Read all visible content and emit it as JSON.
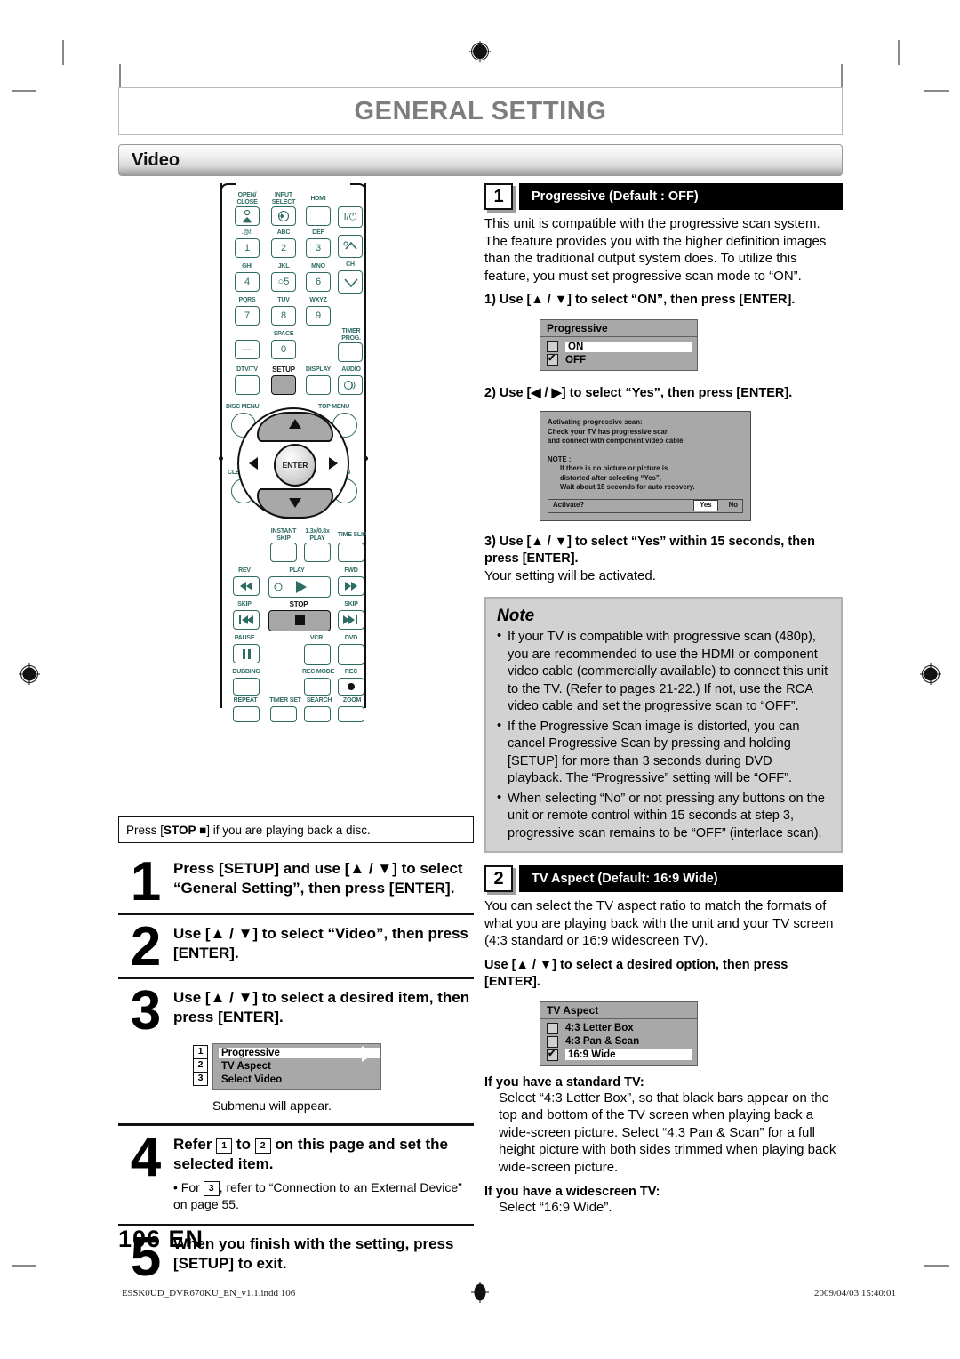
{
  "header": {
    "title": "GENERAL SETTING",
    "section": "Video"
  },
  "remote": {
    "labels": {
      "open_close": "OPEN/\nCLOSE",
      "input_select": "INPUT\nSELECT",
      "hdmi": "HDMI",
      "power": "I/⏻",
      "k1_sub": ".@/:",
      "k2_sub": "ABC",
      "k3_sub": "DEF",
      "k4_sub": "GHI",
      "k5_sub": "JKL",
      "k6_sub": "MNO",
      "k7_sub": "PQRS",
      "k8_sub": "TUV",
      "k9_sub": "WXYZ",
      "k0_sub": "SPACE",
      "n1": "1",
      "n2": "2",
      "n3": "3",
      "n4": "4",
      "n5": "5",
      "n6": "6",
      "n7": "7",
      "n8": "8",
      "n9": "9",
      "n0": "0",
      "dash": "—",
      "ch": "CH",
      "timer_prog": "TIMER\nPROG.",
      "dtv_tv": "DTV/TV",
      "setup": "SETUP",
      "display": "DISPLAY",
      "audio": "AUDIO",
      "disc_menu": "DISC MENU",
      "top_menu": "TOP MENU",
      "enter": "ENTER",
      "clear": "CLEAR",
      "return": "RETURN",
      "instant_skip": "INSTANT\nSKIP",
      "play_13x": "1.3x/0.8x\nPLAY",
      "time_slip": "TIME SLIP",
      "rev": "REV",
      "play": "PLAY",
      "fwd": "FWD",
      "skip_back": "SKIP",
      "stop": "STOP",
      "skip_fwd": "SKIP",
      "pause": "PAUSE",
      "vcr": "VCR",
      "dvd": "DVD",
      "dubbing": "DUBBING",
      "rec_mode": "REC MODE",
      "rec": "REC",
      "repeat": "REPEAT",
      "timer_set": "TIMER SET",
      "search": "SEARCH",
      "zoom": "ZOOM"
    }
  },
  "caption": {
    "prefix": "Press [",
    "bold": "STOP ■",
    "suffix": "] if you are playing back a disc."
  },
  "steps": [
    {
      "num": "1",
      "text": "Press [SETUP] and use [▲ / ▼] to select “General Setting”, then press [ENTER]."
    },
    {
      "num": "2",
      "text": "Use [▲ / ▼] to select “Video”, then press [ENTER]."
    },
    {
      "num": "3",
      "text": "Use [▲ / ▼] to select a desired item, then press [ENTER].",
      "submenu": {
        "items": [
          {
            "tag": "1",
            "label": "Progressive",
            "highlight": true
          },
          {
            "tag": "2",
            "label": "TV Aspect",
            "highlight": false
          },
          {
            "tag": "3",
            "label": "Select Video",
            "highlight": false
          }
        ]
      },
      "note": "Submenu will appear."
    },
    {
      "num": "4",
      "text_parts": [
        "Refer ",
        "1",
        " to ",
        "2",
        " on this page and set the selected item."
      ],
      "bullet_parts": [
        "• For ",
        "3",
        ", refer to “Connection to an External Device” on page 55."
      ]
    },
    {
      "num": "5",
      "text": "When you finish with the setting, press [SETUP] to exit."
    }
  ],
  "sections": [
    {
      "num": "1",
      "title": "Progressive (Default : OFF)",
      "body": "This unit is compatible with the progressive scan system. The feature provides you with the higher definition images than the traditional output system does. To utilize this feature, you must set progressive scan mode to “ON”.",
      "step1": "1) Use [▲ / ▼] to select “ON”, then press [ENTER].",
      "menu": {
        "title": "Progressive",
        "options": [
          {
            "label": "ON",
            "checked": false,
            "selected": true
          },
          {
            "label": "OFF",
            "checked": true,
            "selected": false
          }
        ]
      },
      "step2": "2) Use [◀ / ▶] to select “Yes”, then press [ENTER].",
      "dialog": {
        "line1": "Activating progressive scan:",
        "line2": "Check your TV has progressive scan",
        "line3": "and connect with component video cable.",
        "note_label": "NOTE :",
        "note1": "If there is no picture or picture is",
        "note2": "distorted after selecting “Yes”,",
        "note3": "Wait about 15 seconds for auto recovery.",
        "question": "Activate?",
        "yes": "Yes",
        "no": "No"
      },
      "step3": "3) Use [▲ / ▼] to select “Yes” within 15 seconds, then press [ENTER].",
      "step3_sub": "Your setting will be activated.",
      "note": {
        "title": "Note",
        "items": [
          "If your TV is compatible with progressive scan (480p), you are recommended to use the HDMI or component video cable (commercially available) to connect this unit to the TV. (Refer to pages 21-22.) If not, use the RCA video cable and set the progressive scan to “OFF”.",
          "If the Progressive Scan image is distorted, you can cancel Progressive Scan by pressing and holding [SETUP] for more than 3 seconds during DVD playback. The “Progressive” setting will be “OFF”.",
          "When selecting “No” or not pressing any buttons on the unit or remote control within 15 seconds at step 3, progressive scan remains to be “OFF” (interlace scan)."
        ]
      }
    },
    {
      "num": "2",
      "title": "TV Aspect (Default: 16:9 Wide)",
      "body": "You can select the TV aspect ratio to match the formats of what you are playing back with the unit and your TV screen (4:3 standard or 16:9 widescreen TV).",
      "step1": "Use [▲ / ▼] to select a desired option, then press [ENTER].",
      "menu": {
        "title": "TV Aspect",
        "options": [
          {
            "label": "4:3 Letter Box",
            "checked": false,
            "selected": false
          },
          {
            "label": "4:3 Pan & Scan",
            "checked": false,
            "selected": false
          },
          {
            "label": "16:9 Wide",
            "checked": true,
            "selected": true
          }
        ]
      },
      "standard_tv_head": "If you have a standard TV:",
      "standard_tv_body": "Select “4:3 Letter Box”, so that black bars appear on the top and bottom of the TV screen when playing back a wide-screen picture. Select “4:3 Pan & Scan” for a full height picture with both sides trimmed when playing back wide-screen picture.",
      "wide_tv_head": "If you have a widescreen TV:",
      "wide_tv_body": "Select “16:9 Wide”."
    }
  ],
  "page_number": "106  EN",
  "footer": {
    "left": "E9SK0UD_DVR670KU_EN_v1.1.indd   106",
    "right": "2009/04/03   15:40:01"
  }
}
